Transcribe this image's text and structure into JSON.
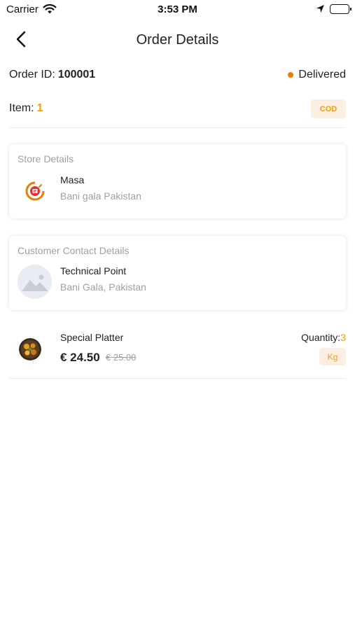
{
  "status_bar": {
    "carrier": "Carrier",
    "time": "3:53 PM"
  },
  "header": {
    "title": "Order Details"
  },
  "order": {
    "id_label": "Order ID:",
    "id_value": "100001",
    "status": "Delivered",
    "item_label": "Item:",
    "item_count": "1",
    "payment_badge": "COD"
  },
  "store_card": {
    "title": "Store Details",
    "name": "Masa",
    "address": "Bani gala Pakistan"
  },
  "customer_card": {
    "title": "Customer Contact Details",
    "name": "Technical Point",
    "address": "Bani Gala, Pakistan"
  },
  "products": [
    {
      "name": "Special Platter",
      "price": "€ 24.50",
      "old_price": "€ 25.00",
      "quantity_label": "Quantity:",
      "quantity_value": "3",
      "unit": "Kg"
    }
  ],
  "colors": {
    "accent": "#f39c12",
    "status_dot": "#f07d00",
    "badge_bg": "#fdeee2",
    "muted": "#a0a0a0"
  },
  "icons": {
    "back": "chevron-left-icon",
    "wifi": "wifi-icon",
    "location": "location-arrow-icon",
    "battery": "battery-icon",
    "placeholder": "image-placeholder-icon"
  }
}
